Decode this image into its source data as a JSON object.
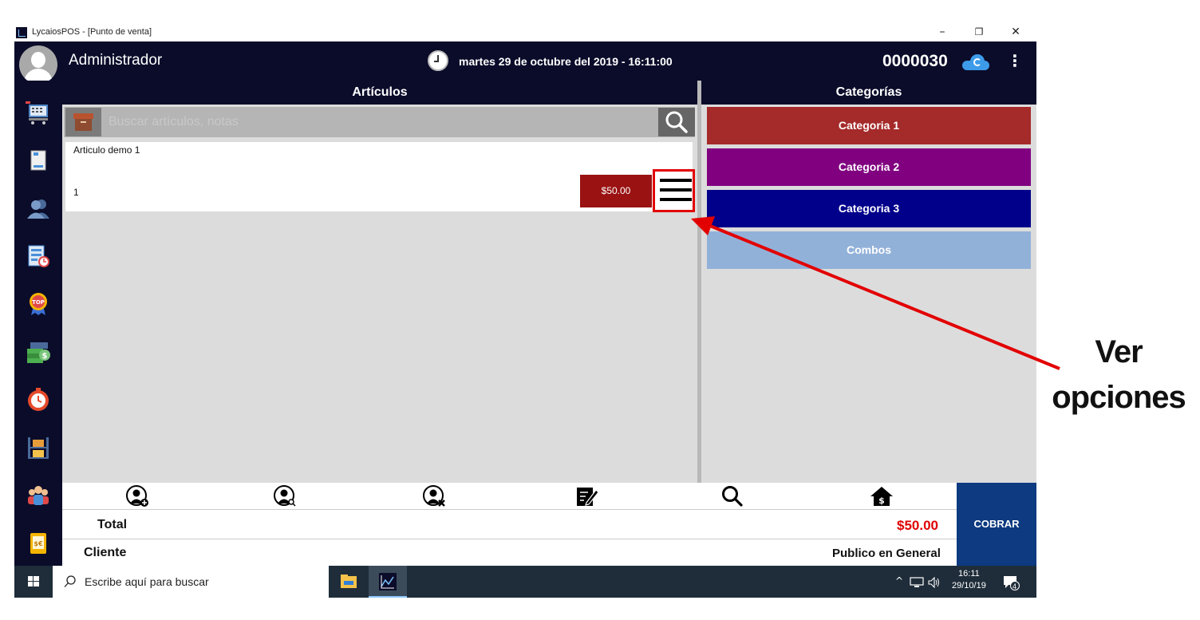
{
  "window": {
    "title": "LycaiosPOS - [Punto de venta]",
    "minimize": "–",
    "restore": "❐",
    "close": "✕"
  },
  "header": {
    "user_name": "Administrador",
    "datetime": "martes 29 de octubre del 2019 - 16:11:00",
    "ticket_number": "0000030",
    "kebab": "⋮"
  },
  "articles": {
    "title": "Artículos",
    "search_placeholder": "Buscar artículos, notas",
    "items": [
      {
        "name": "Articulo demo 1",
        "quantity": "1",
        "price": "$50.00"
      }
    ]
  },
  "categories": {
    "title": "Categorías",
    "items": [
      {
        "label": "Categoria 1",
        "color": "#a52a2a"
      },
      {
        "label": "Categoria 2",
        "color": "#800080"
      },
      {
        "label": "Categoria 3",
        "color": "#00008b"
      },
      {
        "label": "Combos",
        "color": "#92b1d9"
      }
    ]
  },
  "toolbar": {
    "icons": [
      "add-customer-icon",
      "search-customer-icon",
      "remove-customer-icon",
      "edit-note-icon",
      "search-icon",
      "home-price-icon"
    ]
  },
  "summary": {
    "total_label": "Total",
    "total_value": "$50.00",
    "client_label": "Cliente",
    "client_value": "Publico en General",
    "charge_button": "COBRAR"
  },
  "taskbar": {
    "search_text": "Escribe aquí para buscar",
    "time": "16:11",
    "date": "29/10/19",
    "notifications": "4"
  },
  "annotation": {
    "line1": "Ver",
    "line2": "opciones",
    "color": "#e20000"
  }
}
